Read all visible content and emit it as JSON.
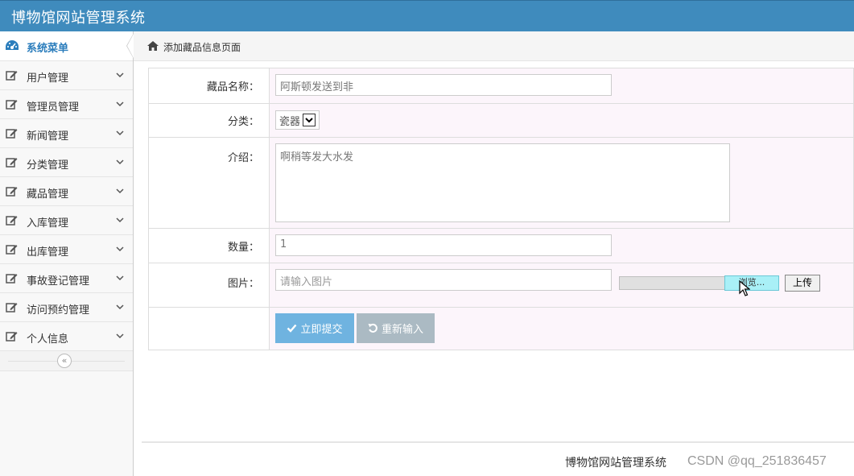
{
  "app": {
    "title": "博物馆网站管理系统"
  },
  "sidebar": {
    "header_label": "系统菜单",
    "items": [
      {
        "label": "用户管理"
      },
      {
        "label": "管理员管理"
      },
      {
        "label": "新闻管理"
      },
      {
        "label": "分类管理"
      },
      {
        "label": "藏品管理"
      },
      {
        "label": "入库管理"
      },
      {
        "label": "出库管理"
      },
      {
        "label": "事故登记管理"
      },
      {
        "label": "访问预约管理"
      },
      {
        "label": "个人信息"
      }
    ],
    "collapse_glyph": "«"
  },
  "breadcrumb": {
    "text": "添加藏品信息页面"
  },
  "form": {
    "name": {
      "label": "藏品名称：",
      "value": "阿斯顿发送到非"
    },
    "category": {
      "label": "分类：",
      "value": "瓷器"
    },
    "intro": {
      "label": "介绍：",
      "value": "啊稍等发大水发"
    },
    "quantity": {
      "label": "数量：",
      "value": "1"
    },
    "image": {
      "label": "图片：",
      "placeholder": "请输入图片",
      "browse_label": "浏览...",
      "upload_label": "上传"
    },
    "submit_label": "立即提交",
    "reset_label": "重新输入"
  },
  "footer": {
    "text": "博物馆网站管理系统"
  },
  "watermark": "CSDN @qq_251836457",
  "colors": {
    "header_bg": "#3f8bbd",
    "accent": "#2b7dbc",
    "submit_bg": "#6fb3e0",
    "reset_bg": "#abbac3"
  }
}
